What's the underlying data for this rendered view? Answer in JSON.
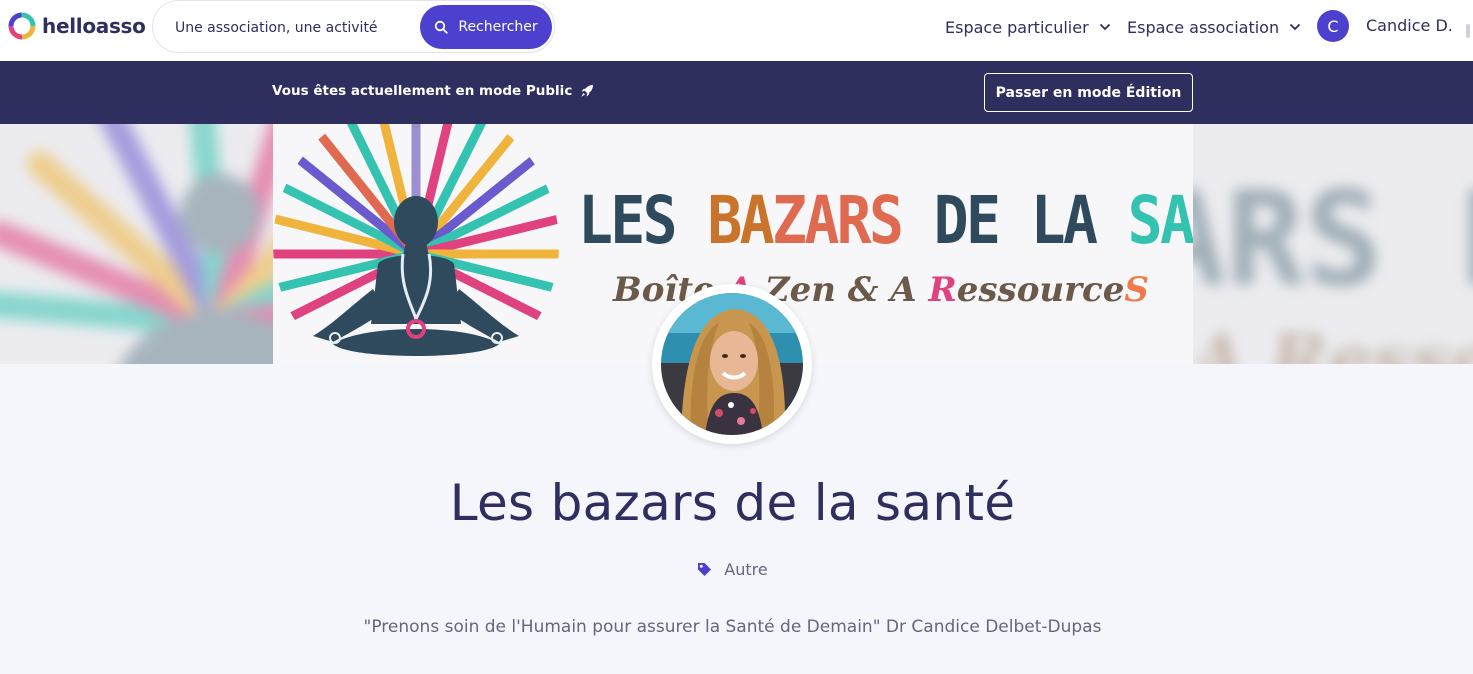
{
  "header": {
    "logo_text": "helloasso",
    "search": {
      "placeholder": "Une association, une activité",
      "button_label": "Rechercher"
    },
    "nav": {
      "espace_particulier": "Espace particulier",
      "espace_association": "Espace association"
    },
    "user": {
      "initial": "C",
      "name": "Candice D."
    }
  },
  "mode_banner": {
    "text": "Vous êtes actuellement en mode Public",
    "edit_button": "Passer en mode Édition"
  },
  "cover": {
    "title_parts": [
      "LES ",
      "BA",
      "Z",
      "ARS",
      " DE LA ",
      "SANTÉ"
    ],
    "subtitle_parts": [
      "Boîte ",
      "A",
      " Zen & A ",
      "R",
      "essource",
      "S"
    ]
  },
  "organization": {
    "name": "Les bazars de la santé",
    "category": "Autre",
    "tagline": "\"Prenons soin de l'Humain pour assurer la Santé de Demain\" Dr Candice Delbet-Dupas"
  },
  "colors": {
    "brand": "#4c40cf",
    "navy": "#2e2f5e",
    "page_bg": "#f5f6fb",
    "muted_text": "#65667f"
  },
  "icons": [
    "helloasso-logo-icon",
    "search-icon",
    "chevron-down-icon",
    "rocket-icon",
    "tag-icon"
  ]
}
